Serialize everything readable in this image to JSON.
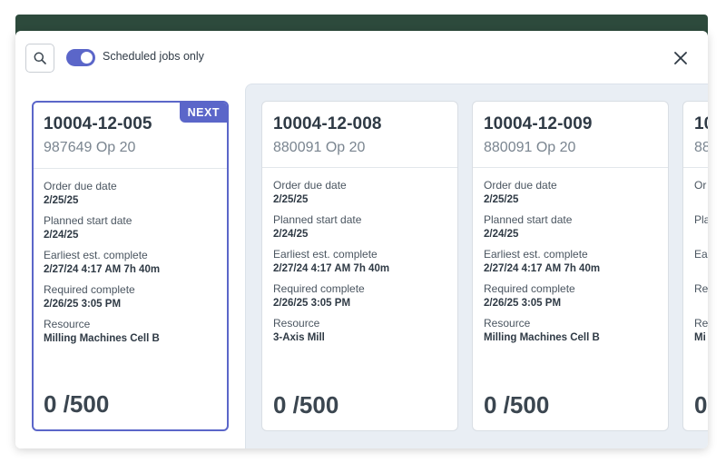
{
  "toolbar": {
    "toggle_label": "Scheduled jobs only",
    "toggle_on": true,
    "accent_color": "#5b66c9"
  },
  "field_labels": {
    "order_due": "Order due date",
    "planned_start": "Planned start date",
    "earliest_complete": "Earliest est. complete",
    "required_complete": "Required complete",
    "resource": "Resource"
  },
  "next_badge": "NEXT",
  "cards": [
    {
      "job": "10004-12-005",
      "operation": "987649  Op 20",
      "order_due": "2/25/25",
      "planned_start": "2/24/25",
      "earliest_complete": "2/27/24 4:17 AM 7h 40m",
      "required_complete": "2/26/25 3:05 PM",
      "resource": "Milling Machines Cell B",
      "quantity": "0 /500"
    },
    {
      "job": "10004-12-008",
      "operation": "880091  Op 20",
      "order_due": "2/25/25",
      "planned_start": "2/24/25",
      "earliest_complete": "2/27/24 4:17 AM 7h 40m",
      "required_complete": "2/26/25 3:05 PM",
      "resource": "3-Axis Mill",
      "quantity": "0 /500"
    },
    {
      "job": "10004-12-009",
      "operation": "880091  Op 20",
      "order_due": "2/25/25",
      "planned_start": "2/24/25",
      "earliest_complete": "2/27/24 4:17 AM 7h 40m",
      "required_complete": "2/26/25 3:05 PM",
      "resource": "Milling Machines Cell B",
      "quantity": "0 /500"
    },
    {
      "job": "10",
      "operation": "88",
      "order_due": "",
      "planned_start": "",
      "earliest_complete": "",
      "required_complete": "",
      "resource": "Mi",
      "quantity": "0"
    }
  ],
  "partial_labels": {
    "order_due": "Or",
    "planned_start": "Pla",
    "earliest_complete": "Ea",
    "required_complete": "Re",
    "resource": "Re"
  }
}
